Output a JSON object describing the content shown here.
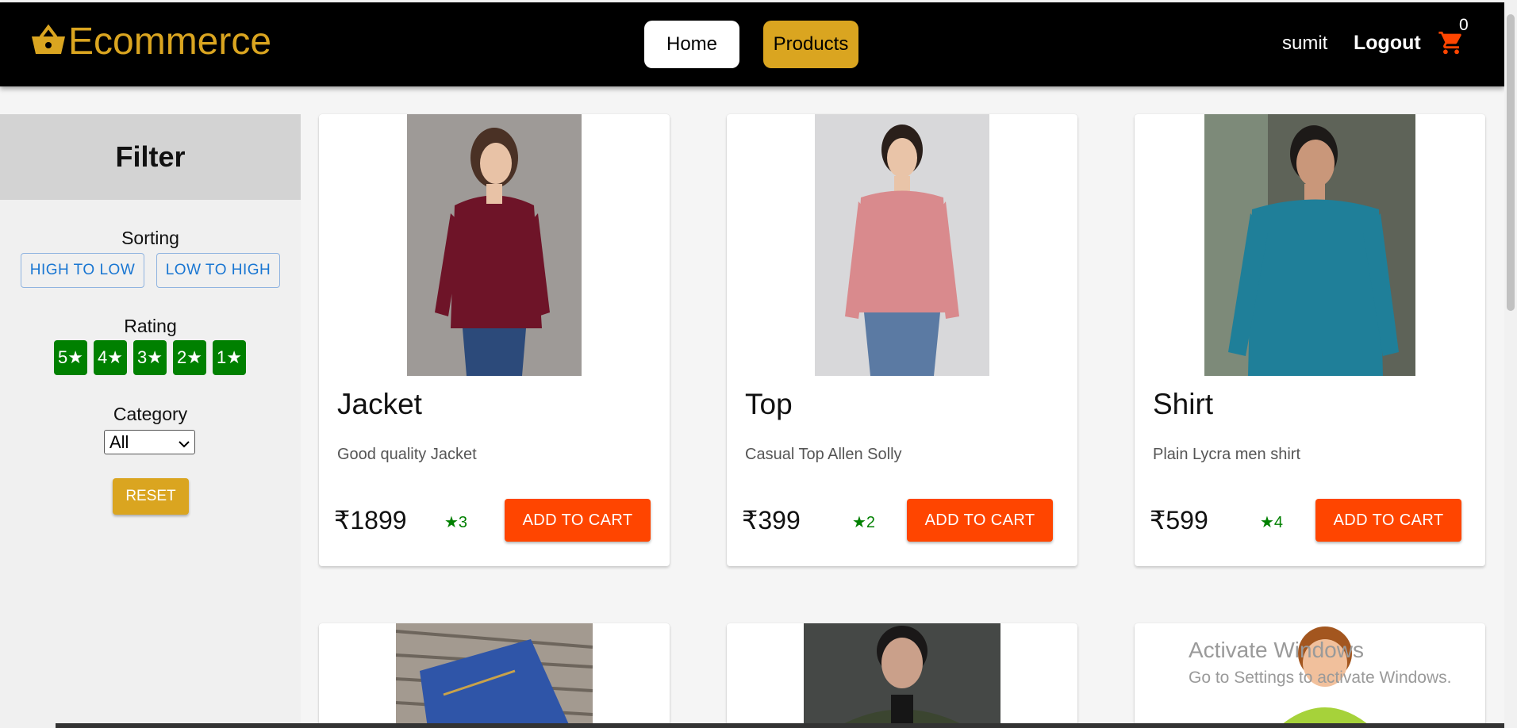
{
  "header": {
    "logo_text": "Ecommerce",
    "nav_home": "Home",
    "nav_products": "Products",
    "username": "sumit",
    "logout": "Logout",
    "cart_count": "0"
  },
  "sidebar": {
    "title": "Filter",
    "sorting_label": "Sorting",
    "sort_high_low": "HIGH TO LOW",
    "sort_low_high": "LOW TO HIGH",
    "rating_label": "Rating",
    "ratings": [
      "5★",
      "4★",
      "3★",
      "2★",
      "1★"
    ],
    "category_label": "Category",
    "category_selected": "All",
    "reset": "RESET"
  },
  "products": [
    {
      "title": "Jacket",
      "description": "Good quality Jacket",
      "price": "₹1899",
      "rating": "★3",
      "button": "ADD TO CART"
    },
    {
      "title": "Top",
      "description": "Casual Top Allen Solly",
      "price": "₹399",
      "rating": "★2",
      "button": "ADD TO CART"
    },
    {
      "title": "Shirt",
      "description": "Plain Lycra men shirt",
      "price": "₹599",
      "rating": "★4",
      "button": "ADD TO CART"
    }
  ],
  "watermark": {
    "line1": "Activate Windows",
    "line2": "Go to Settings to activate Windows."
  },
  "colors": {
    "brand": "#daa520",
    "cart_button": "#ff4500",
    "rating_green": "#008000",
    "sort_blue": "#1976d2"
  }
}
